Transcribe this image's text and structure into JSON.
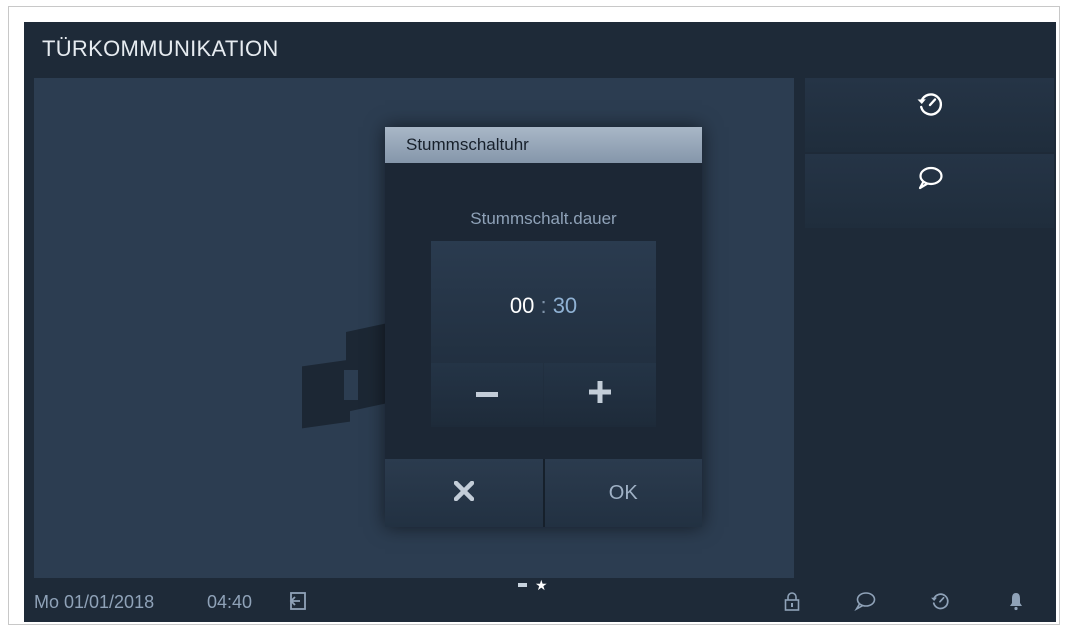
{
  "header": {
    "title": "TÜRKOMMUNIKATION"
  },
  "side_buttons": [
    {
      "icon": "history-icon"
    },
    {
      "icon": "chat-bubble-icon"
    }
  ],
  "dialog": {
    "title": "Stummschaltuhr",
    "subtitle": "Stummschalt.dauer",
    "hours": "00",
    "separator": ":",
    "minutes": "30",
    "minus_icon": "minus-icon",
    "plus_icon": "plus-icon",
    "cancel_icon": "close-icon",
    "ok_label": "OK"
  },
  "status_bar": {
    "date": "Mo 01/01/2018",
    "time": "04:40",
    "icons": [
      "exit-icon",
      "lock-icon",
      "chat-bubble-icon",
      "history-icon",
      "bell-icon"
    ],
    "pager": {
      "pages": 2,
      "active_page": 2
    }
  },
  "colors": {
    "background": "#1e2a38",
    "video_area": "#2c3d51",
    "dialog_header": "#9aa9bb",
    "accent_text": "#8fa2b8"
  }
}
